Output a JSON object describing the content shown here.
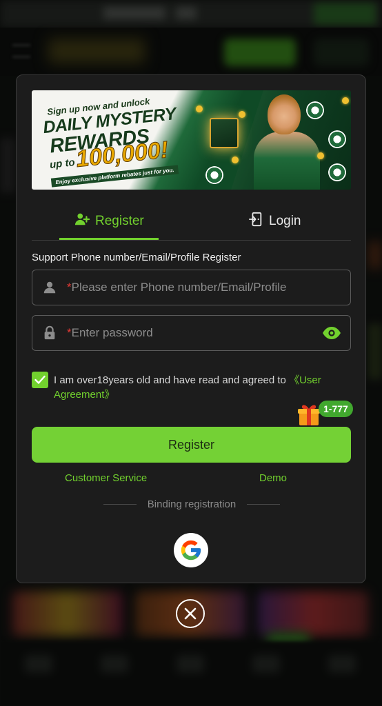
{
  "banner": {
    "line1": "Sign up now and unlock",
    "line2": "DAILY MYSTERY",
    "line3": "REWARDS",
    "line4": "up to",
    "amount": "100,000!",
    "tagline": "Enjoy exclusive platform rebates just for you."
  },
  "tabs": [
    {
      "label": "Register",
      "icon": "add-user-icon",
      "active": true
    },
    {
      "label": "Login",
      "icon": "login-door-icon",
      "active": false
    }
  ],
  "form": {
    "support_label": "Support Phone number/Email/Profile Register",
    "phone_placeholder": "Please enter Phone number/Email/Profile",
    "password_placeholder": "Enter password",
    "required_mark": "*",
    "agree_text": "I am over18years old and have read and agreed to",
    "agree_link": "《User Agreement》",
    "agree_checked": true
  },
  "badge": {
    "text": "1-777"
  },
  "actions": {
    "register_label": "Register",
    "customer_service": "Customer Service",
    "demo": "Demo",
    "binding_label": "Binding registration"
  },
  "colors": {
    "accent": "#72d12e",
    "button": "#74d135",
    "modal_bg": "#1c1c1c",
    "required": "#e53935"
  }
}
